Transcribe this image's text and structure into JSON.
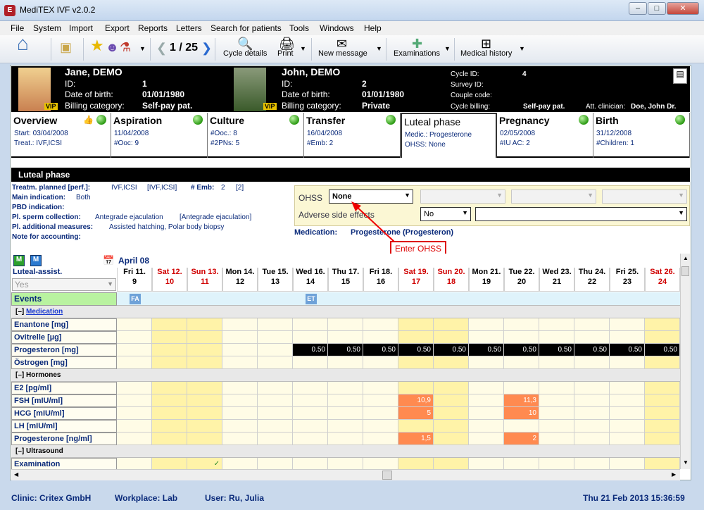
{
  "window": {
    "title": "MediTEX IVF v2.0.2",
    "app_icon": "E"
  },
  "menu": [
    "File",
    "System",
    "Import",
    "Export",
    "Reports",
    "Letters",
    "Search for patients",
    "Tools",
    "Windows",
    "Help"
  ],
  "toolbar": {
    "counter": "1 / 25",
    "cycle_details": "Cycle details",
    "print": "Print",
    "new_message": "New message",
    "examinations": "Examinations",
    "medical_history": "Medical history"
  },
  "female": {
    "name": "Jane, DEMO",
    "id_label": "ID:",
    "id": "1",
    "dob_label": "Date of birth:",
    "dob": "01/01/1980",
    "billing_label": "Billing category:",
    "billing": "Self-pay pat.",
    "vip": "VIP"
  },
  "male": {
    "name": "John, DEMO",
    "id_label": "ID:",
    "id": "2",
    "dob_label": "Date of birth:",
    "dob": "01/01/1980",
    "billing_label": "Billing category:",
    "billing": "Private",
    "vip": "VIP"
  },
  "cycle": {
    "cycle_id_label": "Cycle ID:",
    "cycle_id": "4",
    "survey_id_label": "Survey ID:",
    "couple_code_label": "Couple code:",
    "cycle_billing_label": "Cycle billing:",
    "cycle_billing": "Self-pay pat.",
    "att_clinician_label": "Att. clinician:",
    "att_clinician": "Doe, John Dr."
  },
  "tabs": [
    {
      "h": "Overview",
      "l1": "Start: 03/04/2008",
      "l2": "Treat.: IVF,ICSI"
    },
    {
      "h": "Aspiration",
      "l1": "11/04/2008",
      "l2": "#Ooc: 9"
    },
    {
      "h": "Culture",
      "l1": "#Ooc.: 8",
      "l2": "#2PNs: 5"
    },
    {
      "h": "Transfer",
      "l1": "16/04/2008",
      "l2": "#Emb: 2"
    },
    {
      "h": "Luteal phase",
      "l1": "Medic.: Progesterone",
      "l2": "OHSS: None"
    },
    {
      "h": "Pregnancy",
      "l1": "02/05/2008",
      "l2": "#IU AC: 2"
    },
    {
      "h": "Birth",
      "l1": "31/12/2008",
      "l2": "#Children: 1"
    }
  ],
  "luteal": {
    "header": "Luteal phase",
    "treat_planned": "Treatm. planned",
    "perf": "[perf.]:",
    "treat_value": "IVF,ICSI",
    "treat_value2": "[IVF,ICSI]",
    "emb_label": "# Emb:",
    "emb": "2",
    "emb2": "[2]",
    "main_ind_label": "Main indication:",
    "main_ind": "Both",
    "pbd_label": "PBD indication:",
    "sperm_label": "Pl. sperm collection:",
    "sperm": "Antegrade ejaculation",
    "sperm2": "[Antegrade ejaculation]",
    "measures_label": "Pl. additional measures:",
    "measures": "Assisted hatching, Polar body biopsy",
    "accounting_label": "Note for accounting:",
    "ohss_label": "OHSS",
    "ohss_value": "None",
    "adverse_label": "Adverse side effects",
    "adverse_value": "No",
    "medication_label": "Medication:",
    "medication": "Progesterone (Progesteron)",
    "callout": "Enter OHSS"
  },
  "grid": {
    "month": "April 08",
    "assist_label": "Luteal-assist.",
    "assist_value": "Yes",
    "days": [
      {
        "d": "Fri 11.",
        "n": "9",
        "red": false
      },
      {
        "d": "Sat 12.",
        "n": "10",
        "red": true
      },
      {
        "d": "Sun 13.",
        "n": "11",
        "red": true
      },
      {
        "d": "Mon 14.",
        "n": "12",
        "red": false
      },
      {
        "d": "Tue 15.",
        "n": "13",
        "red": false
      },
      {
        "d": "Wed 16.",
        "n": "14",
        "red": false
      },
      {
        "d": "Thu 17.",
        "n": "15",
        "red": false
      },
      {
        "d": "Fri 18.",
        "n": "16",
        "red": false
      },
      {
        "d": "Sat 19.",
        "n": "17",
        "red": true
      },
      {
        "d": "Sun 20.",
        "n": "18",
        "red": true
      },
      {
        "d": "Mon 21.",
        "n": "19",
        "red": false
      },
      {
        "d": "Tue 22.",
        "n": "20",
        "red": false
      },
      {
        "d": "Wed 23.",
        "n": "21",
        "red": false
      },
      {
        "d": "Thu 24.",
        "n": "22",
        "red": false
      },
      {
        "d": "Fri 25.",
        "n": "23",
        "red": false
      },
      {
        "d": "Sat 26.",
        "n": "24",
        "red": true
      }
    ],
    "events_label": "Events",
    "event_fa": "FA",
    "event_et": "ET",
    "sec_medication": "Medication",
    "sec_hormones": "Hormones",
    "sec_ultrasound": "Ultrasound",
    "collapse": "[–]",
    "med_rows": [
      "Enantone [mg]",
      "Ovitrelle [µg]",
      "Progesteron [mg]",
      "Östrogen [mg]"
    ],
    "progesteron_value": "0.50",
    "hormone_rows": [
      "E2  [pg/ml]",
      "FSH  [mIU/ml]",
      "HCG  [mIU/ml]",
      "LH  [mIU/ml]",
      "Progesterone  [ng/ml]"
    ],
    "hormone_values": {
      "fsh": [
        "10,9",
        "11,3"
      ],
      "hcg": [
        "5",
        "10"
      ],
      "prog": [
        "1,5",
        "2"
      ]
    },
    "us_rows": [
      "Examination"
    ],
    "check": "✓"
  },
  "status": {
    "clinic": "Clinic: Critex GmbH",
    "workplace": "Workplace: Lab",
    "user": "User: Ru, Julia",
    "datetime": "Thu 21 Feb 2013 15:36:59"
  }
}
